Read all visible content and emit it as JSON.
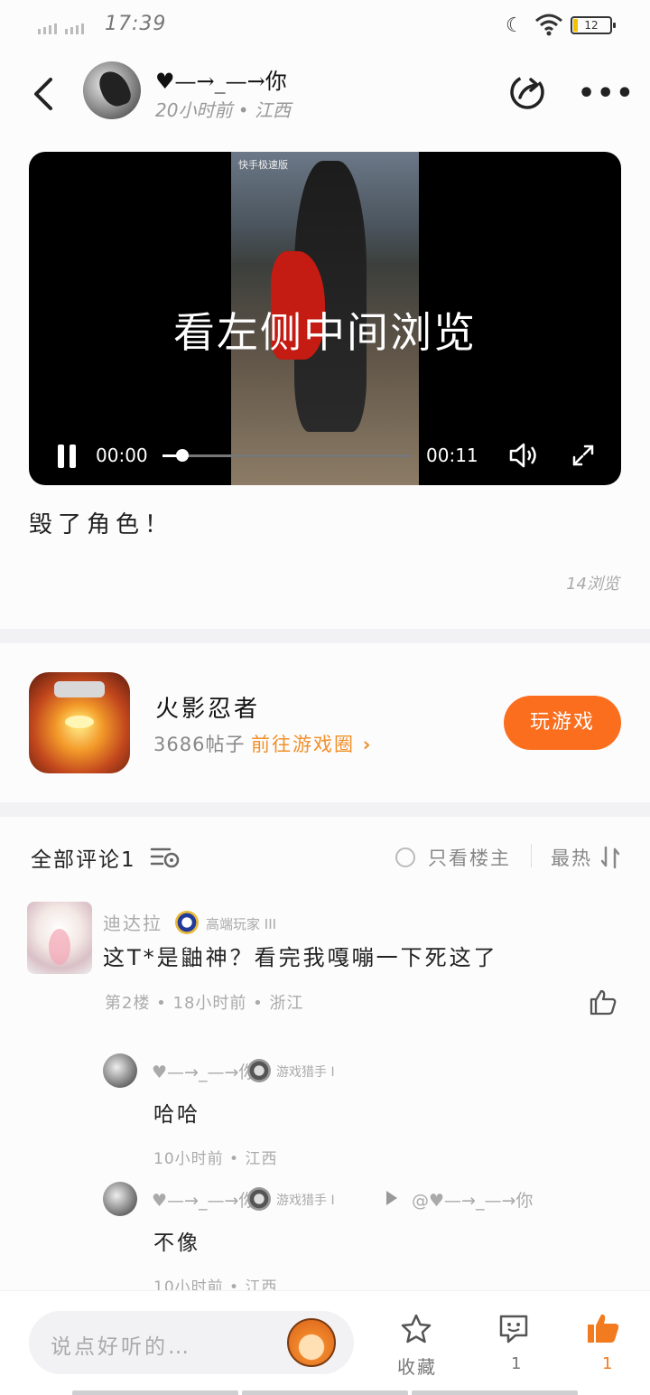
{
  "status_bar": {
    "time": "17:39",
    "battery": "12"
  },
  "header": {
    "author": "♥—→_—→你",
    "meta": "20小时前 • 江西"
  },
  "video": {
    "watermark_app": "快手极速版",
    "overlay_text": "看左侧中间浏览",
    "current_time": "00:00",
    "duration": "00:11",
    "progress": 0.08
  },
  "post": {
    "text": "毁了角色！",
    "views": "14浏览"
  },
  "game": {
    "name": "火影忍者",
    "posts": "3686帖子",
    "goto_label": "前往游戏圈",
    "play_label": "玩游戏"
  },
  "comments": {
    "title": "全部评论1",
    "only_host_label": "只看楼主",
    "sort_label": "最热",
    "items": [
      {
        "name": "迪达拉",
        "level": "高端玩家 III",
        "text": "这T*是鼬神？看完我嘎嘣一下死这了",
        "meta": "第2楼 • 18小时前 • 浙江",
        "replies": [
          {
            "name": "♥—→_—→你",
            "level": "游戏猎手 I",
            "text": "哈哈",
            "meta": "10小时前 • 江西",
            "reply_to": ""
          },
          {
            "name": "♥—→_—→你",
            "level": "游戏猎手 I",
            "text": "不像",
            "meta": "10小时前 • 江西",
            "reply_to": "@♥—→_—→你"
          }
        ]
      }
    ]
  },
  "bottom_bar": {
    "input_placeholder": "说点好听的…",
    "favorite_label": "收藏",
    "comment_count": "1",
    "like_count": "1"
  },
  "colors": {
    "accent": "#fa6e1e",
    "link": "#f0902a",
    "like": "#f27b1f"
  }
}
